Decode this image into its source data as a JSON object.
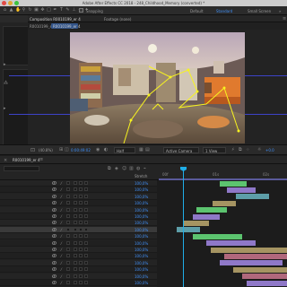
{
  "window": {
    "title": "Adobe After Effects CC 2018 - 248_Childhood_Memory (converted) *",
    "traffic_colors": [
      "#e14b46",
      "#e0a630",
      "#3ec340"
    ]
  },
  "toolbar": {
    "snapping_label": "Snapping",
    "workspaces": [
      "Default",
      "Standard",
      "Small Screen"
    ],
    "active_workspace": "Standard",
    "workspace_chevron": "»"
  },
  "composition": {
    "tab_label": "Composition R0010199_er 4",
    "footage_label": "Footage (none)",
    "subtabs": [
      "R0010199_er 2",
      "R0010199_er 4"
    ],
    "active_subtab": "R0010199_er 4"
  },
  "footer": {
    "zoom": "(40.8%)",
    "timecode": "0:00:49:02",
    "resolution": "Half",
    "camera": "Active Camera",
    "views": "1 View",
    "exposure": "+0.0"
  },
  "timeline": {
    "tab_label": "R0010199_er 4",
    "column_stretch": "Stretch",
    "ruler_labels": [
      "00f",
      "01s",
      "02s"
    ],
    "stretch_values": [
      "100,0%",
      "100,0%",
      "100,0%",
      "100,0%",
      "100,0%",
      "100,0%",
      "100,0%",
      "100,0%",
      "100,0%",
      "100,0%",
      "100,0%",
      "100,0%",
      "100,0%",
      "100,0%",
      "100,0%",
      "100,0%"
    ],
    "selected_row": 7
  },
  "colors": {
    "accent_blue": "#3f8ff7",
    "cti": "#1faee8",
    "guide": "#3d43c9",
    "bar_green": "#5cc46f",
    "bar_purple": "#8f78c8",
    "bar_tan": "#a59462",
    "bar_teal": "#5d9ea8",
    "bar_rose": "#b0687c"
  }
}
